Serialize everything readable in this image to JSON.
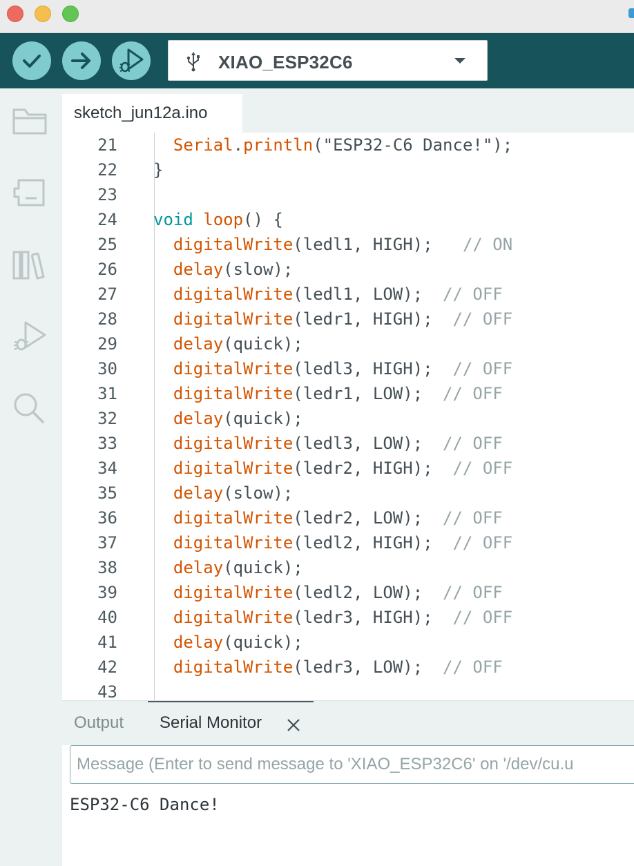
{
  "window": {
    "buttons": [
      "close",
      "minimize",
      "zoom"
    ]
  },
  "toolbar": {
    "verify_icon": "checkmark-icon",
    "upload_icon": "arrow-right-icon",
    "debug_icon": "debug-icon",
    "board_icon": "usb-icon",
    "board_name": "XIAO_ESP32C6",
    "accent_color": "#17535a",
    "button_color": "#7fcbcd"
  },
  "sidebar": {
    "items": [
      {
        "name": "sketchbook",
        "icon": "folder-icon"
      },
      {
        "name": "boards-manager",
        "icon": "board-icon"
      },
      {
        "name": "library-manager",
        "icon": "library-icon"
      },
      {
        "name": "debug",
        "icon": "debug-icon"
      },
      {
        "name": "search",
        "icon": "search-icon"
      }
    ]
  },
  "editor": {
    "tab_label": "sketch_jun12a.ino",
    "lines": [
      {
        "n": "21",
        "segs": [
          {
            "t": "  "
          },
          {
            "t": "Serial",
            "c": "fn"
          },
          {
            "t": "."
          },
          {
            "t": "println",
            "c": "fn"
          },
          {
            "t": "(\"ESP32-C6 Dance!\");"
          }
        ]
      },
      {
        "n": "22",
        "segs": [
          {
            "t": "}"
          }
        ]
      },
      {
        "n": "23",
        "segs": []
      },
      {
        "n": "24",
        "segs": [
          {
            "t": "void",
            "c": "kw"
          },
          {
            "t": " "
          },
          {
            "t": "loop",
            "c": "fn"
          },
          {
            "t": "() {"
          }
        ]
      },
      {
        "n": "25",
        "segs": [
          {
            "t": "  "
          },
          {
            "t": "digitalWrite",
            "c": "fn"
          },
          {
            "t": "(ledl1, HIGH);   "
          },
          {
            "t": "// ON",
            "c": "cm"
          }
        ]
      },
      {
        "n": "26",
        "segs": [
          {
            "t": "  "
          },
          {
            "t": "delay",
            "c": "fn"
          },
          {
            "t": "(slow);"
          }
        ]
      },
      {
        "n": "27",
        "segs": [
          {
            "t": "  "
          },
          {
            "t": "digitalWrite",
            "c": "fn"
          },
          {
            "t": "(ledl1, LOW);  "
          },
          {
            "t": "// OFF",
            "c": "cm"
          }
        ]
      },
      {
        "n": "28",
        "segs": [
          {
            "t": "  "
          },
          {
            "t": "digitalWrite",
            "c": "fn"
          },
          {
            "t": "(ledr1, HIGH);  "
          },
          {
            "t": "// OFF",
            "c": "cm"
          }
        ]
      },
      {
        "n": "29",
        "segs": [
          {
            "t": "  "
          },
          {
            "t": "delay",
            "c": "fn"
          },
          {
            "t": "(quick);"
          }
        ]
      },
      {
        "n": "30",
        "segs": [
          {
            "t": "  "
          },
          {
            "t": "digitalWrite",
            "c": "fn"
          },
          {
            "t": "(ledl3, HIGH);  "
          },
          {
            "t": "// OFF",
            "c": "cm"
          }
        ]
      },
      {
        "n": "31",
        "segs": [
          {
            "t": "  "
          },
          {
            "t": "digitalWrite",
            "c": "fn"
          },
          {
            "t": "(ledr1, LOW);  "
          },
          {
            "t": "// OFF",
            "c": "cm"
          }
        ]
      },
      {
        "n": "32",
        "segs": [
          {
            "t": "  "
          },
          {
            "t": "delay",
            "c": "fn"
          },
          {
            "t": "(quick);"
          }
        ]
      },
      {
        "n": "33",
        "segs": [
          {
            "t": "  "
          },
          {
            "t": "digitalWrite",
            "c": "fn"
          },
          {
            "t": "(ledl3, LOW);  "
          },
          {
            "t": "// OFF",
            "c": "cm"
          }
        ]
      },
      {
        "n": "34",
        "segs": [
          {
            "t": "  "
          },
          {
            "t": "digitalWrite",
            "c": "fn"
          },
          {
            "t": "(ledr2, HIGH);  "
          },
          {
            "t": "// OFF",
            "c": "cm"
          }
        ]
      },
      {
        "n": "35",
        "segs": [
          {
            "t": "  "
          },
          {
            "t": "delay",
            "c": "fn"
          },
          {
            "t": "(slow);"
          }
        ]
      },
      {
        "n": "36",
        "segs": [
          {
            "t": "  "
          },
          {
            "t": "digitalWrite",
            "c": "fn"
          },
          {
            "t": "(ledr2, LOW);  "
          },
          {
            "t": "// OFF",
            "c": "cm"
          }
        ]
      },
      {
        "n": "37",
        "segs": [
          {
            "t": "  "
          },
          {
            "t": "digitalWrite",
            "c": "fn"
          },
          {
            "t": "(ledl2, HIGH);  "
          },
          {
            "t": "// OFF",
            "c": "cm"
          }
        ]
      },
      {
        "n": "38",
        "segs": [
          {
            "t": "  "
          },
          {
            "t": "delay",
            "c": "fn"
          },
          {
            "t": "(quick);"
          }
        ]
      },
      {
        "n": "39",
        "segs": [
          {
            "t": "  "
          },
          {
            "t": "digitalWrite",
            "c": "fn"
          },
          {
            "t": "(ledl2, LOW);  "
          },
          {
            "t": "// OFF",
            "c": "cm"
          }
        ]
      },
      {
        "n": "40",
        "segs": [
          {
            "t": "  "
          },
          {
            "t": "digitalWrite",
            "c": "fn"
          },
          {
            "t": "(ledr3, HIGH);  "
          },
          {
            "t": "// OFF",
            "c": "cm"
          }
        ]
      },
      {
        "n": "41",
        "segs": [
          {
            "t": "  "
          },
          {
            "t": "delay",
            "c": "fn"
          },
          {
            "t": "(quick);"
          }
        ]
      },
      {
        "n": "42",
        "segs": [
          {
            "t": "  "
          },
          {
            "t": "digitalWrite",
            "c": "fn"
          },
          {
            "t": "(ledr3, LOW);  "
          },
          {
            "t": "// OFF",
            "c": "cm"
          }
        ]
      },
      {
        "n": "43",
        "segs": []
      }
    ],
    "syntax_colors": {
      "kw": "#00979c",
      "fn": "#d35400",
      "cm": "#95a5a6",
      "text": "#434f54"
    }
  },
  "panel": {
    "output_tab": "Output",
    "serial_tab": "Serial Monitor",
    "close_icon": "close-icon",
    "message_placeholder": "Message (Enter to send message to 'XIAO_ESP32C6' on '/dev/cu.u",
    "message_value": "",
    "serial_output": "ESP32-C6 Dance!"
  }
}
